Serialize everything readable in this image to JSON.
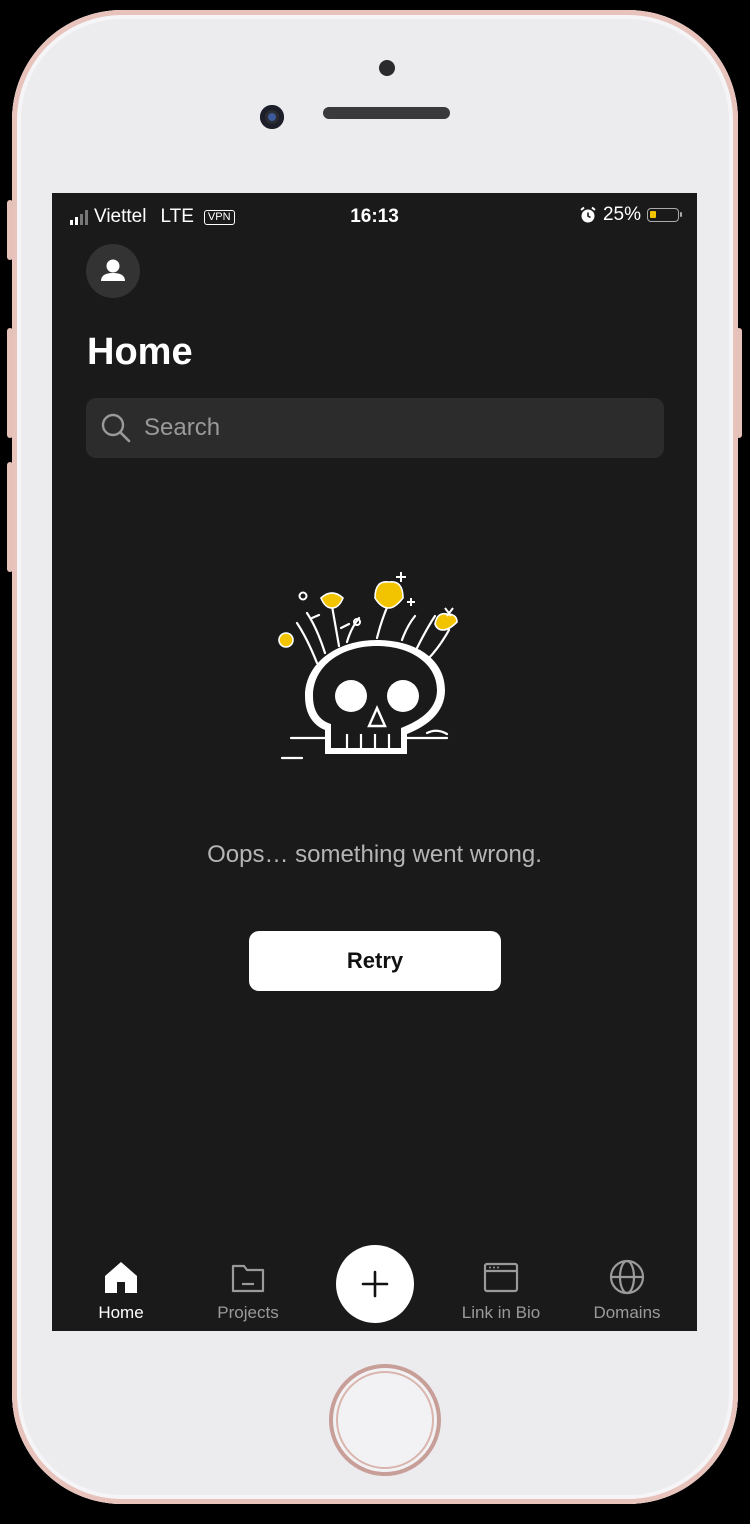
{
  "status_bar": {
    "carrier": "Viettel",
    "network": "LTE",
    "vpn": "VPN",
    "time": "16:13",
    "battery": "25%"
  },
  "header": {
    "title": "Home",
    "avatar_icon": "user-icon"
  },
  "search": {
    "placeholder": "Search",
    "icon": "search-icon"
  },
  "error": {
    "illustration": "skull-with-flowers-illustration",
    "message": "Oops… something went wrong.",
    "retry_label": "Retry"
  },
  "tabbar": {
    "tabs": [
      {
        "label": "Home",
        "icon": "home-icon",
        "active": true
      },
      {
        "label": "Projects",
        "icon": "folder-icon"
      },
      {
        "label": "Link in Bio",
        "icon": "browser-window-icon"
      },
      {
        "label": "Domains",
        "icon": "globe-icon"
      }
    ],
    "fab_icon": "plus-icon"
  },
  "colors": {
    "background": "#1a1a1a",
    "accent": "#f2c400",
    "text_muted": "#9a9a9a"
  }
}
